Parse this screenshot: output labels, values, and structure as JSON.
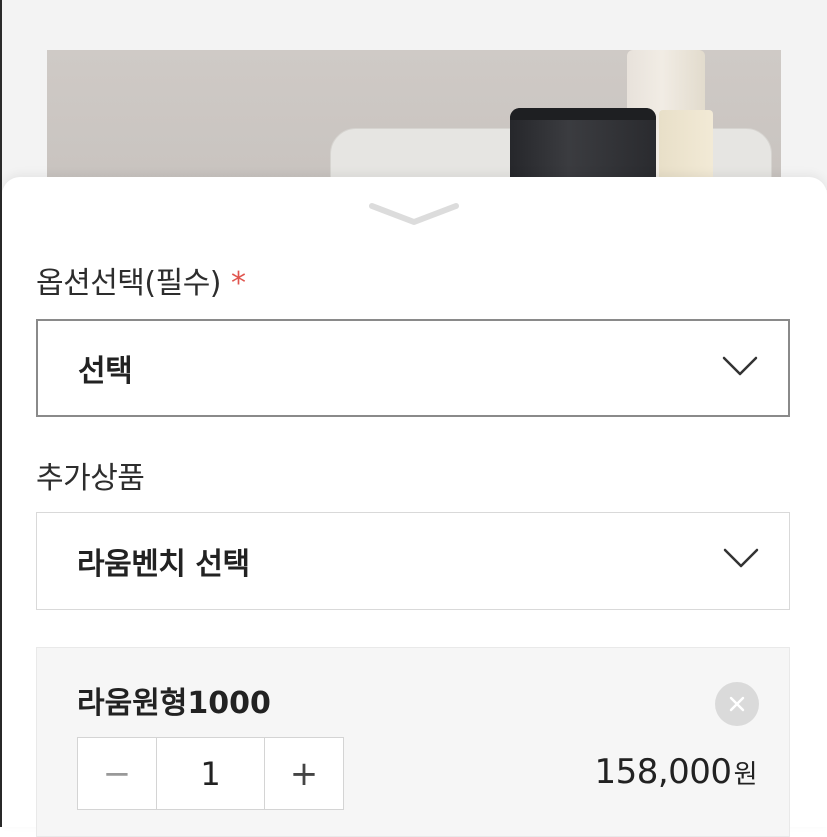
{
  "option_section": {
    "label": "옵션선택(필수)",
    "required_mark": "*",
    "selected_value": "선택"
  },
  "extra_section": {
    "label": "추가상품",
    "selected_value": "라움벤치 선택"
  },
  "selected_item": {
    "name": "라움원형1000",
    "quantity": "1",
    "minus_label": "−",
    "plus_label": "+",
    "price": "158,000",
    "price_unit": "원"
  },
  "icons": {
    "collapse": "chevron-down-icon",
    "dropdown": "chevron-down-icon",
    "remove": "close-icon"
  },
  "colors": {
    "required_mark": "#e0554e"
  }
}
